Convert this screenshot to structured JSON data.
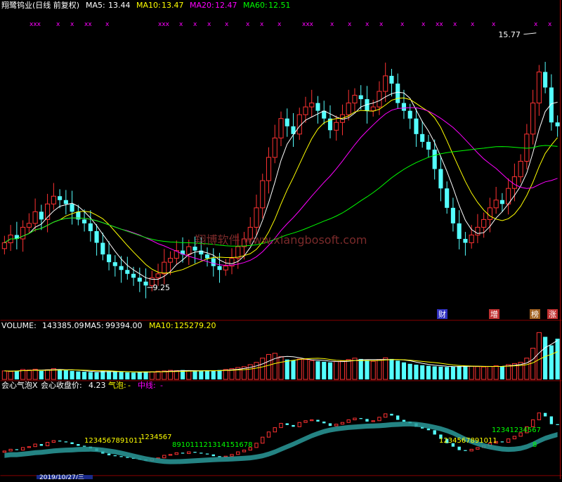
{
  "colors": {
    "background": "#000000",
    "up": "#ff3232",
    "down": "#54ffff",
    "grid": "#aa0000",
    "ma5": "#ffffff",
    "ma10": "#ffff00",
    "ma20": "#ff00ff",
    "ma60": "#00ff00",
    "magenta_label": "#ff00ff",
    "yellow_label": "#ffff00",
    "green_label": "#00ff00",
    "band_up": "#b07a7a",
    "band_down": "#2a9a9a"
  },
  "header": {
    "stock_name": "翔鹭钨业(日线 前复权)",
    "ma5_label": "MA5:",
    "ma5_value": "13.44",
    "ma10_label": "MA10:",
    "ma10_value": "13.47",
    "ma20_label": "MA20:",
    "ma20_value": "12.47",
    "ma60_label": "MA60:",
    "ma60_value": "12.51"
  },
  "price_panel": {
    "high_label": "15.77",
    "low_label": "9.25",
    "watermark": "翔博软件  www.xiangbosoft.com",
    "event_markers": [
      {
        "text": "财",
        "bg": "#3030c0"
      },
      {
        "text": "增",
        "bg": "#c03030"
      },
      {
        "text": "榜",
        "bg": "#a06020"
      },
      {
        "text": "涨",
        "bg": "#c03030"
      }
    ],
    "top_marks": [
      "xxx",
      "x",
      "x",
      "xx",
      "x",
      "xxx",
      "x",
      "x",
      "x",
      "x",
      "x",
      "x",
      "x",
      "xxx",
      "x",
      "x",
      "x",
      "x",
      "x",
      "x",
      "xx",
      "x",
      "x",
      "x",
      "x",
      "x"
    ]
  },
  "volume_panel": {
    "label": "VOLUME:",
    "value": "143385.09",
    "ma5_label": "MA5:",
    "ma5_value": "99394.00",
    "ma10_label": "MA10:",
    "ma10_value": "125279.20"
  },
  "indicator_panel": {
    "label": "会心气泡X",
    "close_label": "会心收盘价:",
    "close_value": "4.23",
    "bubble_label": "气泡:",
    "bubble_value": "-",
    "midline_label": "中线:",
    "midline_value": "-",
    "count_labels": [
      {
        "text": "1234567891011",
        "color": "#ffff00"
      },
      {
        "text": "1234567",
        "color": "#ffff00"
      },
      {
        "text": "891011121314151678",
        "color": "#00ff00"
      },
      {
        "text": "1234567891011",
        "color": "#ffff00"
      },
      {
        "text": "12341234567",
        "color": "#00ff00"
      },
      {
        "text": "8",
        "color": "#00ff00"
      }
    ]
  },
  "footer": {
    "date_label": "2019/10/27/三"
  },
  "chart_data": {
    "type": "candlestick",
    "ylim": [
      8.6,
      16.4
    ],
    "high": 15.77,
    "low": 9.25,
    "moving_averages": {
      "MA5": 13.44,
      "MA10": 13.47,
      "MA20": 12.47,
      "MA60": 12.51
    },
    "volume": {
      "latest": 143385.09,
      "MA5": 99394.0,
      "MA10": 125279.2
    },
    "closes": [
      10.4,
      10.6,
      10.5,
      10.8,
      10.9,
      11.2,
      11.0,
      11.4,
      11.6,
      11.5,
      11.4,
      11.2,
      11.0,
      10.9,
      10.7,
      10.4,
      10.1,
      9.9,
      9.8,
      9.7,
      9.6,
      9.5,
      9.4,
      9.3,
      9.5,
      9.6,
      9.9,
      10.0,
      10.2,
      10.1,
      10.3,
      10.2,
      10.1,
      10.0,
      9.8,
      9.7,
      9.8,
      10.0,
      10.3,
      10.5,
      10.8,
      11.3,
      12.0,
      12.6,
      13.1,
      13.6,
      13.4,
      13.2,
      13.7,
      13.9,
      14.0,
      13.8,
      13.6,
      13.3,
      13.5,
      13.7,
      14.0,
      14.2,
      14.1,
      13.8,
      13.9,
      14.3,
      14.7,
      14.5,
      14.0,
      13.8,
      13.6,
      13.2,
      13.0,
      12.8,
      12.3,
      11.8,
      11.3,
      10.9,
      10.5,
      10.4,
      10.6,
      10.8,
      11.0,
      11.3,
      11.5,
      11.4,
      11.8,
      12.1,
      12.5,
      13.2,
      14.0,
      14.8,
      14.4,
      13.5,
      13.4
    ],
    "volumes": [
      30000,
      28000,
      31000,
      35000,
      33000,
      36000,
      30000,
      34000,
      38000,
      36000,
      32000,
      30000,
      28000,
      27000,
      26000,
      25000,
      30000,
      29000,
      27000,
      26000,
      25000,
      24000,
      26000,
      28000,
      27000,
      29000,
      30000,
      32000,
      31000,
      33000,
      30000,
      29000,
      31000,
      32000,
      30000,
      33000,
      35000,
      38000,
      42000,
      45000,
      52000,
      60000,
      75000,
      88000,
      92000,
      80000,
      70000,
      68000,
      72000,
      70000,
      66000,
      64000,
      62000,
      60000,
      63000,
      65000,
      70000,
      75000,
      72000,
      68000,
      64000,
      70000,
      76000,
      72000,
      66000,
      60000,
      55000,
      52000,
      50000,
      48000,
      46000,
      45000,
      44000,
      45000,
      47000,
      48000,
      46000,
      45000,
      44000,
      46000,
      48000,
      47000,
      52000,
      56000,
      60000,
      75000,
      110000,
      165000,
      150000,
      120000,
      143385.09
    ]
  }
}
